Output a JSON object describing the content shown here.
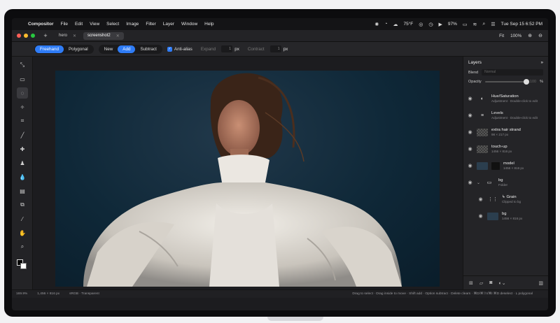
{
  "menubar": {
    "app": "Compositor",
    "menus": [
      "File",
      "Edit",
      "View",
      "Select",
      "Image",
      "Filter",
      "Layer",
      "Window",
      "Help"
    ],
    "weather": "75°F",
    "battery": "97%",
    "clock": "Tue Sep 15  6:52 PM"
  },
  "tabs": [
    {
      "label": "hero"
    },
    {
      "label": "screenshot2"
    }
  ],
  "toolbar_right": {
    "fit": "Fit",
    "zoom": "100%"
  },
  "options": {
    "mode": [
      "Freehand",
      "Polygonal"
    ],
    "ops": [
      "New",
      "Add",
      "Subtract"
    ],
    "antialias": "Anti-alias",
    "expand": "Expand",
    "expand_val": "1",
    "contract": "Contract",
    "contract_val": "1",
    "unit": "px"
  },
  "layers_panel": {
    "title": "Layers",
    "blend_label": "Blend",
    "blend_value": "Normal",
    "opacity_label": "Opacity",
    "opacity_value": "100",
    "opacity_unit": "%",
    "opacity": 1.0,
    "items": [
      {
        "name": "Hue/Saturation",
        "sub": "Adjustment · Double-click to edit"
      },
      {
        "name": "Levels",
        "sub": "Adjustment · Double-click to edit"
      },
      {
        "name": "extra hair strand",
        "sub": "98 × 217 px"
      },
      {
        "name": "touch-up",
        "sub": "1456 × 816 px"
      },
      {
        "name": "model",
        "sub": "1456 × 816 px"
      },
      {
        "name": "bg",
        "sub": "Folder"
      },
      {
        "name": "↳ Grain",
        "sub": "Clipped to bg"
      },
      {
        "name": "bg",
        "sub": "1456 × 816 px"
      }
    ]
  },
  "status": {
    "zoom": "169.9%",
    "size": "1,456 × 816 px",
    "profile": "sRGB · Transparent",
    "hint": "Drag to select · Drag inside to move · Shift add · Option subtract · Delete clears · ⌘D/⌘⇧I/⌘I  ⌘D deselect · L polygonal"
  },
  "colors": {
    "accent": "#2f7cf6",
    "canvas_bg": "#0f2838"
  }
}
